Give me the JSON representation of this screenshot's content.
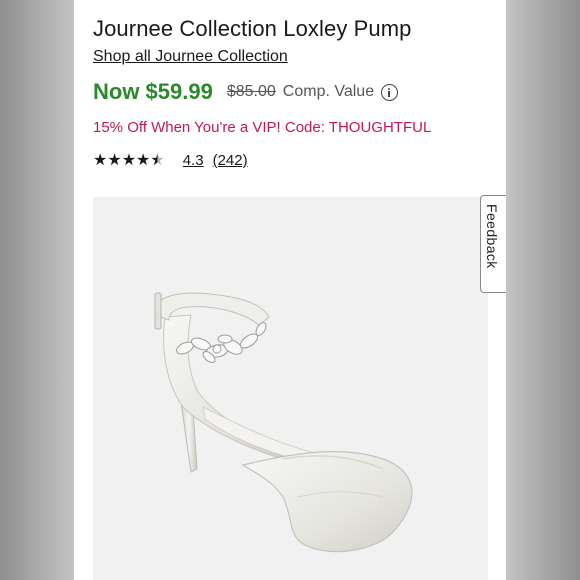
{
  "product": {
    "title": "Journee Collection Loxley Pump",
    "shop_link": "Shop all Journee Collection"
  },
  "price": {
    "now": "Now $59.99",
    "original": "$85.00",
    "comp_label": "Comp. Value",
    "now_color": "#2a8a2a"
  },
  "promo": {
    "text": "15% Off When You're a VIP! Code: THOUGHTFUL",
    "color": "#c2185b"
  },
  "rating": {
    "value": "4.3",
    "count": "(242)",
    "stars": 4.3
  },
  "feedback": {
    "label": "Feedback"
  },
  "image": {
    "icon": "shoe-image",
    "background": "#f1f1f1"
  }
}
